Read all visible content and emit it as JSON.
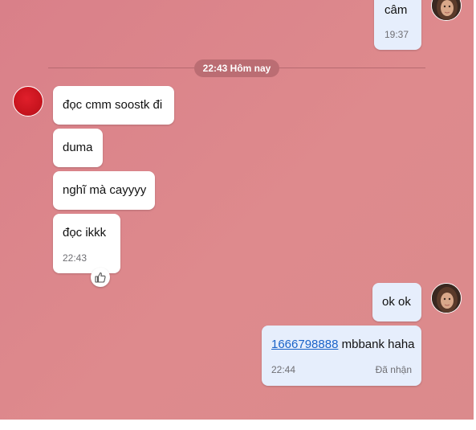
{
  "colors": {
    "chat_background": "#d98089",
    "incoming_bubble": "#ffffff",
    "outgoing_bubble": "#e6eefc",
    "divider_pill": "#bb6d73",
    "link": "#1a63c9"
  },
  "top_message": {
    "text": "câm",
    "time": "19:37"
  },
  "divider": {
    "label": "22:43 Hôm nay"
  },
  "incoming": [
    {
      "text": "đọc cmm soostk đi"
    },
    {
      "text": "duma"
    },
    {
      "text": "nghĩ mà cayyyy"
    },
    {
      "text": "đọc ikkk",
      "time": "22:43",
      "reaction": "thumbs-up-icon"
    }
  ],
  "outgoing": [
    {
      "text": "ok ok"
    },
    {
      "link": "1666798888",
      "text": " mbbank haha",
      "time": "22:44",
      "status": "Đã nhận"
    }
  ]
}
